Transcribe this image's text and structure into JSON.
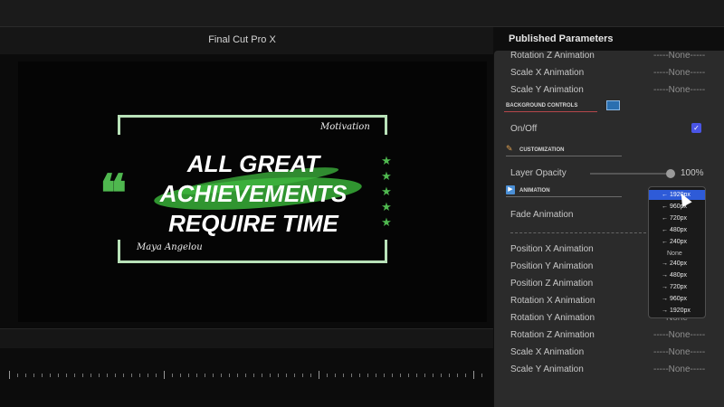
{
  "app": {
    "title": "Final Cut Pro X"
  },
  "title_card": {
    "line1": "ALL GREAT",
    "line2": "ACHIEVEMENTS",
    "line3": "REQUIRE TIME",
    "tag": "Motivation",
    "author": "Maya Angelou",
    "quote_mark": "❝",
    "stars": [
      "★",
      "★",
      "★",
      "★",
      "★"
    ],
    "accent_color": "#4fb84f",
    "frame_color": "#b9e2b9"
  },
  "panel": {
    "title": "Published Parameters",
    "top_rows": [
      {
        "label": "Rotation Z Animation",
        "value": "-----None-----"
      },
      {
        "label": "Scale X Animation",
        "value": "-----None-----"
      },
      {
        "label": "Scale Y Animation",
        "value": "-----None-----"
      }
    ],
    "background_controls": "BACKGROUND CONTROLS",
    "onoff": {
      "label": "On/Off",
      "checked": true,
      "check_glyph": "✓"
    },
    "customization": "CUSTOMIZATION",
    "layer_opacity": {
      "label": "Layer Opacity",
      "value": "100%"
    },
    "animation": "ANIMATION",
    "fade_animation": {
      "label": "Fade Animation"
    },
    "bottom_rows": [
      {
        "label": "Position X Animation",
        "value": ""
      },
      {
        "label": "Position Y Animation",
        "value": ""
      },
      {
        "label": "Position Z Animation",
        "value": ""
      },
      {
        "label": "Rotation X Animation",
        "value": ""
      },
      {
        "label": "Rotation Y Animation",
        "value": "None"
      },
      {
        "label": "Rotation Z Animation",
        "value": "-----None-----"
      },
      {
        "label": "Scale X Animation",
        "value": "-----None-----"
      },
      {
        "label": "Scale Y Animation",
        "value": "-----None-----"
      }
    ]
  },
  "dropdown": {
    "options": [
      "← 1920px",
      "← 960px",
      "← 720px",
      "← 480px",
      "← 240px",
      "None",
      "→ 240px",
      "→ 480px",
      "→ 720px",
      "→ 960px",
      "→ 1920px"
    ],
    "selected": 0
  }
}
